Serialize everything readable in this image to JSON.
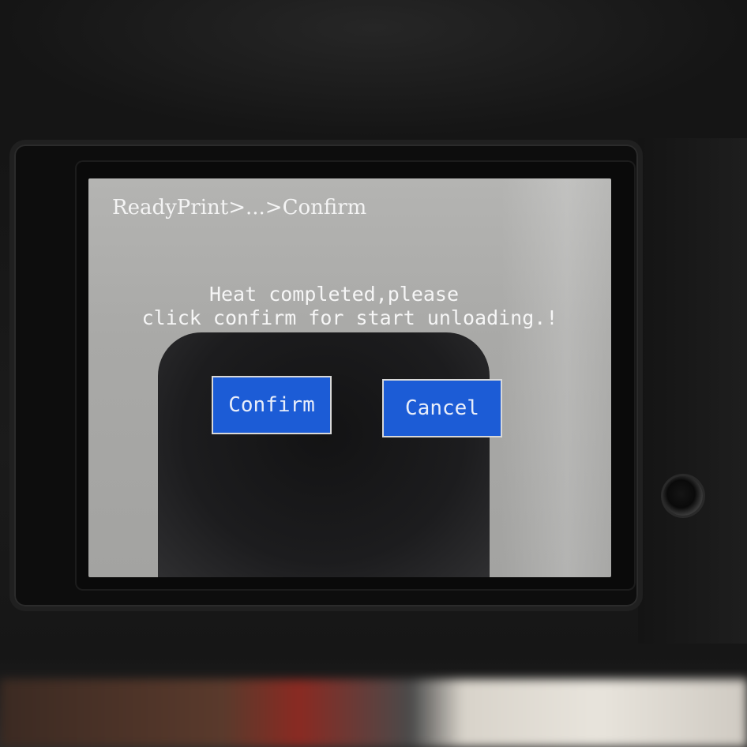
{
  "screen": {
    "breadcrumb": "ReadyPrint>...>Confirm",
    "message_line1": "Heat completed,please",
    "message_line2": "click confirm for start unloading.!",
    "confirm_label": "Confirm",
    "cancel_label": "Cancel"
  },
  "colors": {
    "button_bg": "#1c5cd6",
    "screen_bg": "#b0b0ae",
    "text": "#f6f6f6"
  }
}
